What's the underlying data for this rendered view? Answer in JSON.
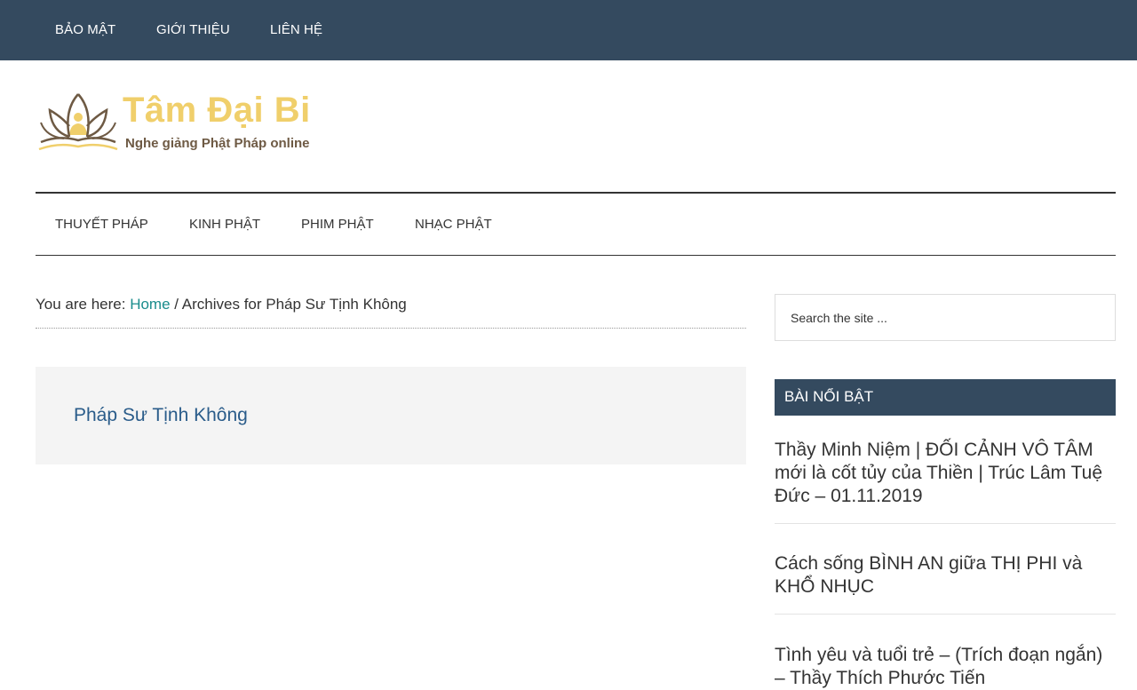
{
  "top_nav": [
    "BẢO MẬT",
    "GIỚI THIỆU",
    "LIÊN HỆ"
  ],
  "site": {
    "title": "Tâm Đại Bi",
    "description": "Nghe giảng Phật Pháp online",
    "logo_icon": "lotus-buddha-icon"
  },
  "main_nav": [
    "THUYẾT PHÁP",
    "KINH PHẬT",
    "PHIM PHẬT",
    "NHẠC PHẬT"
  ],
  "breadcrumb": {
    "prefix": "You are here: ",
    "home": "Home",
    "separator": " / ",
    "current": "Archives for Pháp Sư Tịnh Không"
  },
  "archive": {
    "title": "Pháp Sư Tịnh Không"
  },
  "sidebar": {
    "search_placeholder": "Search the site ...",
    "widget_title": "BÀI NỔI BẬT",
    "posts": [
      "Thầy Minh Niệm | ĐỐI CẢNH VÔ TÂM mới là cốt tủy của Thiền | Trúc Lâm Tuệ Đức – 01.11.2019",
      "Cách sống BÌNH AN giữa THỊ PHI và KHỔ NHỤC",
      "Tình yêu và tuổi trẻ – (Trích đoạn ngắn) – Thầy Thích Phước Tiến"
    ]
  },
  "colors": {
    "nav_bg": "#344a5f",
    "logo_gold": "#f0cf6b",
    "link_teal": "#1a8c8c",
    "archive_title": "#2a5c8a"
  }
}
